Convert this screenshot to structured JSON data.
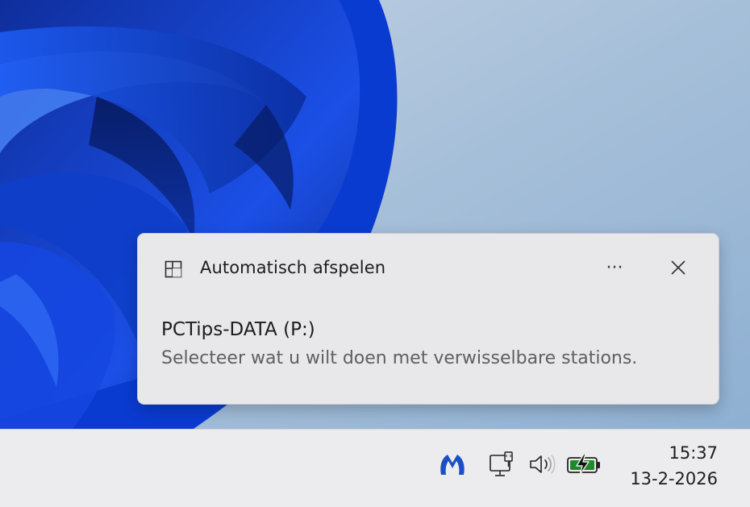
{
  "notification": {
    "app_icon": "autoplay-icon",
    "app_name": "Automatisch afspelen",
    "more_icon": "more-options-icon",
    "more_label": "···",
    "close_icon": "close-icon",
    "title": "PCTips-DATA (P:)",
    "body": "Selecteer wat u wilt doen met verwisselbare stations."
  },
  "taskbar": {
    "tray_icons": [
      "malwarebytes-icon",
      "network-icon",
      "volume-icon",
      "battery-charging-icon"
    ],
    "clock": {
      "time": "15:37",
      "date": "13-2-2026"
    }
  },
  "colors": {
    "malwarebytes": "#1c4fc4",
    "battery_fill": "#1f8a2c",
    "wallpaper_accent": "#0a3fd6"
  }
}
